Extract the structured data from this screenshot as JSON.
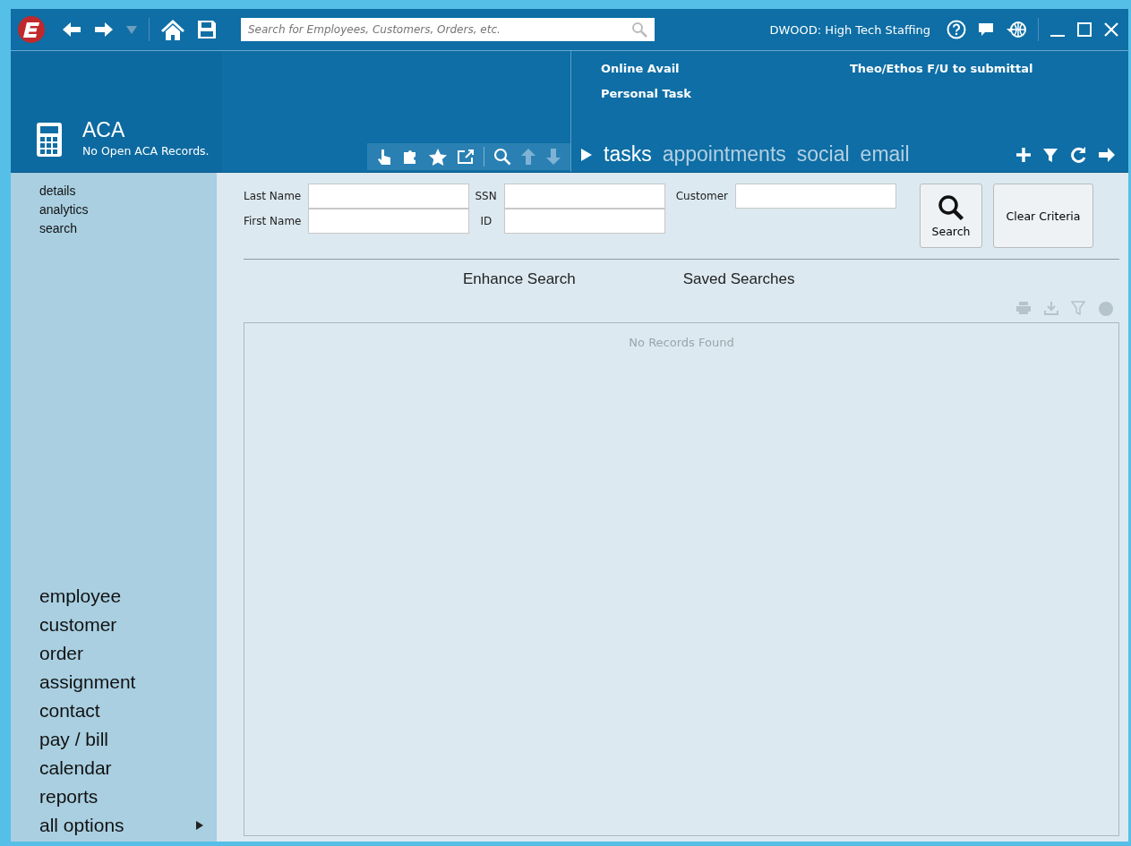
{
  "titlebar": {
    "search": {
      "placeholder": "Search for Employees, Customers, Orders, etc."
    },
    "user": "DWOOD: High Tech Staffing"
  },
  "module": {
    "title": "ACA",
    "subtitle": "No Open ACA Records."
  },
  "reminders": [
    {
      "text": "Online Avail"
    },
    {
      "text": "Theo/Ethos F/U to submittal"
    },
    {
      "text": "Personal Task"
    }
  ],
  "tabs": [
    {
      "label": "tasks",
      "selected": true
    },
    {
      "label": "appointments",
      "selected": false
    },
    {
      "label": "social",
      "selected": false
    },
    {
      "label": "email",
      "selected": false
    }
  ],
  "sidebar": {
    "links": [
      "details",
      "analytics",
      "search"
    ],
    "nav": [
      {
        "label": "employee"
      },
      {
        "label": "customer"
      },
      {
        "label": "order"
      },
      {
        "label": "assignment"
      },
      {
        "label": "contact"
      },
      {
        "label": "pay / bill"
      },
      {
        "label": "calendar"
      },
      {
        "label": "reports"
      },
      {
        "label": "all options",
        "submenu": true
      }
    ]
  },
  "criteria": [
    {
      "label": "Last Name"
    },
    {
      "label": "SSN"
    },
    {
      "label": "Customer"
    },
    {
      "label": "First Name"
    },
    {
      "label": "ID"
    }
  ],
  "buttons": {
    "search": "Search",
    "clear": "Clear Criteria"
  },
  "subtabs": [
    "Enhance Search",
    "Saved Searches"
  ],
  "results": {
    "empty": "No Records Found"
  }
}
